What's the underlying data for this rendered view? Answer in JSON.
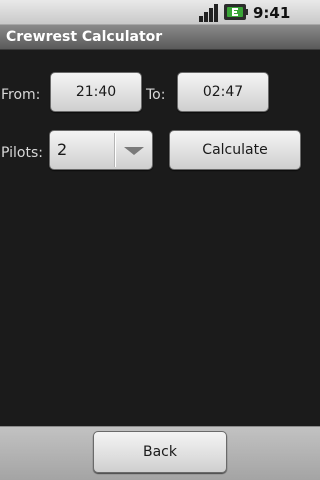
{
  "status_bar": {
    "time": "9:41 PM",
    "icons": [
      "signal-icon",
      "battery-icon"
    ]
  },
  "app": {
    "title": "Crewrest Calculator"
  },
  "form": {
    "from_label": "From:",
    "from_value": "21:40",
    "to_label": "To:",
    "to_value": "02:47",
    "pilots_label": "Pilots:",
    "pilots_value": "2",
    "calculate_label": "Calculate"
  },
  "footer": {
    "back_label": "Back"
  },
  "colors": {
    "background": "#1b1b1b",
    "title_bar": "#6f6f6f",
    "button_face": "#e2e2e2",
    "battery_green": "#3aa537"
  }
}
